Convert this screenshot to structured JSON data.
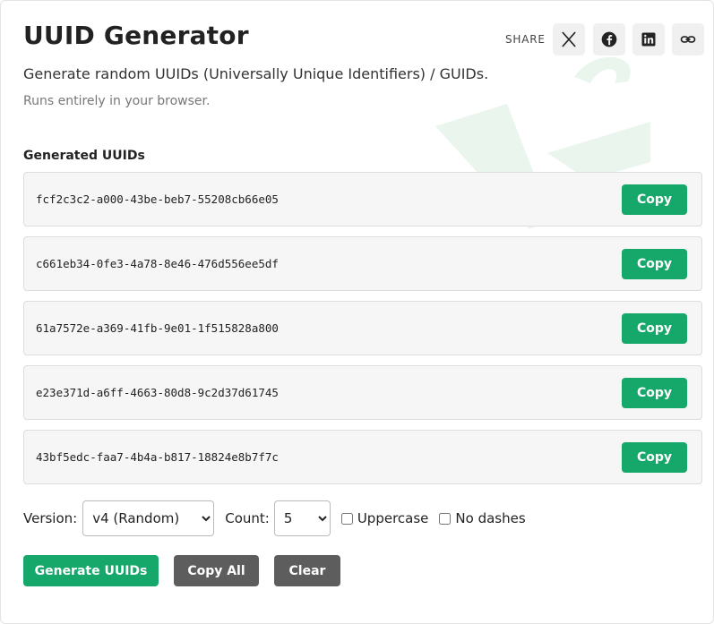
{
  "header": {
    "title": "UUID Generator",
    "subtitle": "Generate random UUIDs (Universally Unique Identifiers) / GUIDs.",
    "note": "Runs entirely in your browser."
  },
  "share": {
    "label": "SHARE",
    "buttons": [
      {
        "icon": "x-icon"
      },
      {
        "icon": "facebook-icon"
      },
      {
        "icon": "linkedin-icon"
      },
      {
        "icon": "link-icon"
      }
    ]
  },
  "results": {
    "label": "Generated UUIDs",
    "copy_label": "Copy",
    "uuids": [
      "fcf2c3c2-a000-43be-beb7-55208cb66e05",
      "c661eb34-0fe3-4a78-8e46-476d556ee5df",
      "61a7572e-a369-41fb-9e01-1f515828a800",
      "e23e371d-a6ff-4663-80d8-9c2d37d61745",
      "43bf5edc-faa7-4b4a-b817-18824e8b7f7c"
    ]
  },
  "controls": {
    "version_label": "Version:",
    "version_value": "v4 (Random)",
    "count_label": "Count:",
    "count_value": "5",
    "uppercase_label": "Uppercase",
    "uppercase_checked": false,
    "nodashes_label": "No dashes",
    "nodashes_checked": false
  },
  "actions": {
    "generate_label": "Generate UUIDs",
    "copy_all_label": "Copy All",
    "clear_label": "Clear"
  },
  "colors": {
    "accent": "#16a86b",
    "secondary_button": "#5d5d5d",
    "watermark": "#eaf5ee"
  }
}
